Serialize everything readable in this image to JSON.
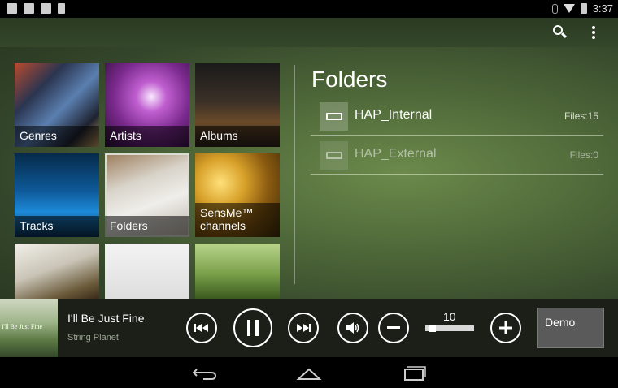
{
  "status_bar": {
    "time": "3:37"
  },
  "action_bar": {
    "search_icon": "search-icon",
    "overflow_icon": "more-vert-icon"
  },
  "tiles": [
    {
      "label": "Genres"
    },
    {
      "label": "Artists"
    },
    {
      "label": "Albums"
    },
    {
      "label": "Tracks"
    },
    {
      "label": "Folders",
      "selected": true
    },
    {
      "label": "SensMe™ channels"
    },
    {
      "label": ""
    },
    {
      "label": ""
    },
    {
      "label": ""
    }
  ],
  "folders_panel": {
    "title": "Folders",
    "items": [
      {
        "name": "HAP_Internal",
        "count": "Files:15",
        "icon": "internal-storage-icon"
      },
      {
        "name": "HAP_External",
        "count": "Files:0",
        "icon": "external-storage-icon"
      }
    ]
  },
  "player": {
    "album_art_text": "I'll Be Just Fine",
    "track_title": "I'll Be Just Fine",
    "artist": "String Planet",
    "volume": "10",
    "volume_fraction": 0.1,
    "demo_label": "Demo"
  },
  "colors": {
    "background_accent": "#4d6638",
    "player_bar": "#1b1f18"
  }
}
